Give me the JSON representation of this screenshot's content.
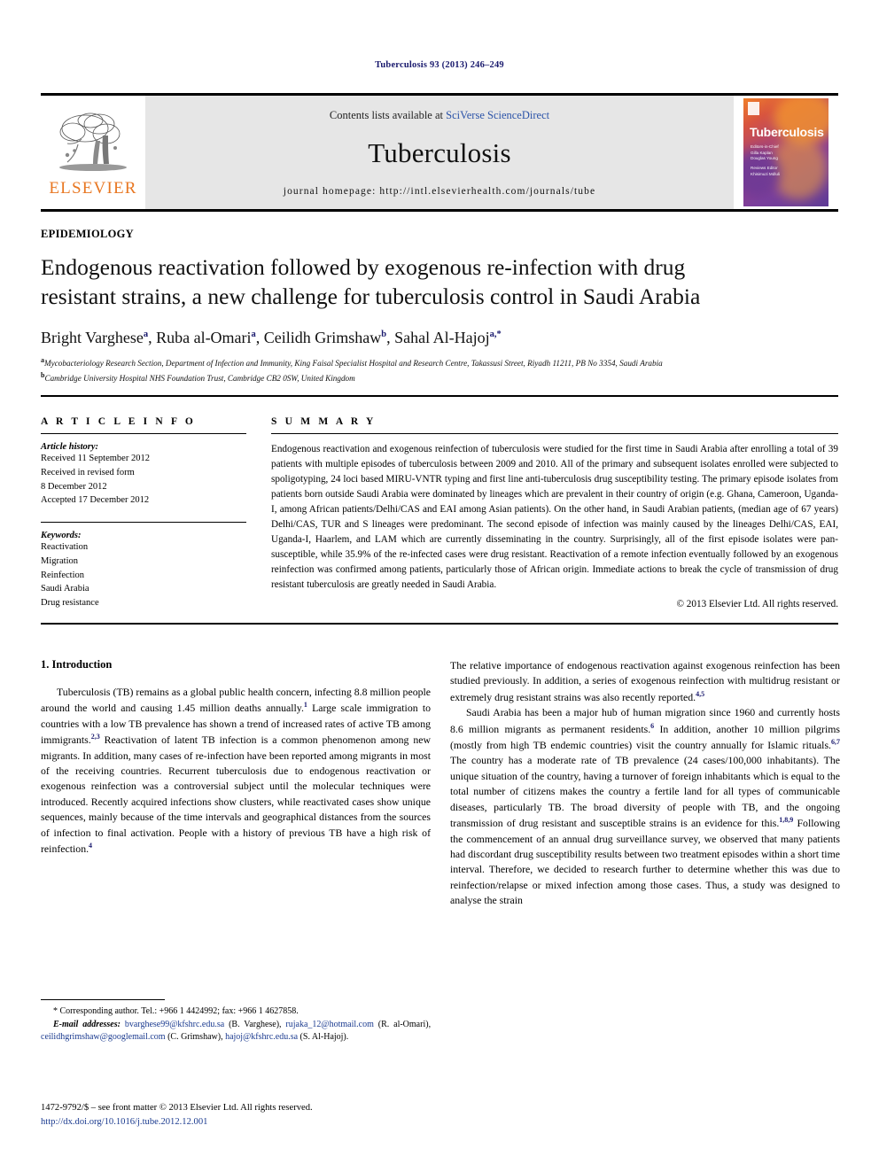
{
  "running_head": "Tuberculosis 93 (2013) 246–249",
  "masthead": {
    "publisher_name": "ELSEVIER",
    "contents_prefix": "Contents lists available at ",
    "contents_link": "SciVerse ScienceDirect",
    "journal_name": "Tuberculosis",
    "homepage_line": "journal homepage: http://intl.elsevierhealth.com/journals/tube",
    "cover_title": "Tuberculosis",
    "cover_sub_1": "Editors-in-Chief",
    "cover_sub_2": "Gilla Kaplan",
    "cover_sub_3": "Douglas Young",
    "cover_sub_4": "Reviews Editor",
    "cover_sub_5": "Khisimuzi Mdluli"
  },
  "article": {
    "section_label": "EPIDEMIOLOGY",
    "title": "Endogenous reactivation followed by exogenous re-infection with drug resistant strains, a new challenge for tuberculosis control in Saudi Arabia",
    "authors": [
      {
        "name": "Bright Varghese",
        "marks": "a"
      },
      {
        "name": "Ruba al-Omari",
        "marks": "a"
      },
      {
        "name": "Ceilidh Grimshaw",
        "marks": "b"
      },
      {
        "name": "Sahal Al-Hajoj",
        "marks": "a,*"
      }
    ],
    "affiliations": [
      {
        "mark": "a",
        "text": "Mycobacteriology Research Section, Department of Infection and Immunity, King Faisal Specialist Hospital and Research Centre, Takassusi Street, Riyadh 11211, PB No 3354, Saudi Arabia"
      },
      {
        "mark": "b",
        "text": "Cambridge University Hospital NHS Foundation Trust, Cambridge CB2 0SW, United Kingdom"
      }
    ]
  },
  "info": {
    "heading": "A R T I C L E   I N F O",
    "history_label": "Article history:",
    "history_lines": [
      "Received 11 September 2012",
      "Received in revised form",
      "8 December 2012",
      "Accepted 17 December 2012"
    ],
    "keywords_label": "Keywords:",
    "keywords": [
      "Reactivation",
      "Migration",
      "Reinfection",
      "Saudi Arabia",
      "Drug resistance"
    ]
  },
  "summary": {
    "heading": "S U M M A R Y",
    "text": "Endogenous reactivation and exogenous reinfection of tuberculosis were studied for the first time in Saudi Arabia after enrolling a total of 39 patients with multiple episodes of tuberculosis between 2009 and 2010. All of the primary and subsequent isolates enrolled were subjected to spoligotyping, 24 loci based MIRU-VNTR typing and first line anti-tuberculosis drug susceptibility testing. The primary episode isolates from patients born outside Saudi Arabia were dominated by lineages which are prevalent in their country of origin (e.g. Ghana, Cameroon, Uganda-I, among African patients/Delhi/CAS and EAI among Asian patients). On the other hand, in Saudi Arabian patients, (median age of 67 years) Delhi/CAS, TUR and S lineages were predominant. The second episode of infection was mainly caused by the lineages Delhi/CAS, EAI, Uganda-I, Haarlem, and LAM which are currently disseminating in the country. Surprisingly, all of the first episode isolates were pan-susceptible, while 35.9% of the re-infected cases were drug resistant. Reactivation of a remote infection eventually followed by an exogenous reinfection was confirmed among patients, particularly those of African origin. Immediate actions to break the cycle of transmission of drug resistant tuberculosis are greatly needed in Saudi Arabia.",
    "copyright": "© 2013 Elsevier Ltd. All rights reserved."
  },
  "body": {
    "intro_heading": "1.  Introduction",
    "left_paragraphs": [
      "Tuberculosis (TB) remains as a global public health concern, infecting 8.8 million people around the world and causing 1.45 million deaths annually.",
      "Large scale immigration to countries with a low TB prevalence has shown a trend of increased rates of active TB among immigrants.",
      "Reactivation of latent TB infection is a common phenomenon among new migrants. In addition, many cases of re-infection have been reported among migrants in most of the receiving countries. Recurrent tuberculosis due to endogenous reactivation or exogenous reinfection was a controversial subject until the molecular techniques were introduced. Recently acquired infections show clusters, while reactivated cases show unique sequences, mainly because of the time intervals and geographical distances from the sources of infection to final activation. People with a history of previous TB have a high risk of reinfection."
    ],
    "left_refs": [
      "1",
      "2,3",
      "4"
    ],
    "right_paragraphs": [
      "The relative importance of endogenous reactivation against exogenous reinfection has been studied previously. In addition, a series of exogenous reinfection with multidrug resistant or extremely drug resistant strains was also recently reported.",
      "Saudi Arabia has been a major hub of human migration since 1960 and currently hosts 8.6 million migrants as permanent residents.",
      "In addition, another 10 million pilgrims (mostly from high TB endemic countries) visit the country annually for Islamic rituals.",
      "The country has a moderate rate of TB prevalence (24 cases/100,000 inhabitants). The unique situation of the country, having a turnover of foreign inhabitants which is equal to the total number of citizens makes the country a fertile land for all types of communicable diseases, particularly TB. The broad diversity of people with TB, and the ongoing transmission of drug resistant and susceptible strains is an evidence for this.",
      "Following the commencement of an annual drug surveillance survey, we observed that many patients had discordant drug susceptibility results between two treatment episodes within a short time interval. Therefore, we decided to research further to determine whether this was due to reinfection/relapse or mixed infection among those cases. Thus, a study was designed to analyse the strain"
    ],
    "right_refs": [
      "4,5",
      "6",
      "6,7",
      "1,8,9"
    ]
  },
  "footnotes": {
    "corresponding": "* Corresponding author. Tel.: +966 1 4424992; fax: +966 1 4627858.",
    "email_label": "E-mail addresses:",
    "emails": [
      {
        "address": "bvarghese99@kfshrc.edu.sa",
        "owner": "(B. Varghese)"
      },
      {
        "address": "rujaka_12@hotmail.com",
        "owner": "(R. al-Omari)"
      },
      {
        "address": "ceilidhgrimshaw@googlemail.com",
        "owner": "(C. Grimshaw)"
      },
      {
        "address": "hajoj@kfshrc.edu.sa",
        "owner": "(S. Al-Hajoj)"
      }
    ]
  },
  "imprint": {
    "line": "1472-9792/$ – see front matter © 2013 Elsevier Ltd. All rights reserved.",
    "doi": "http://dx.doi.org/10.1016/j.tube.2012.12.001"
  }
}
